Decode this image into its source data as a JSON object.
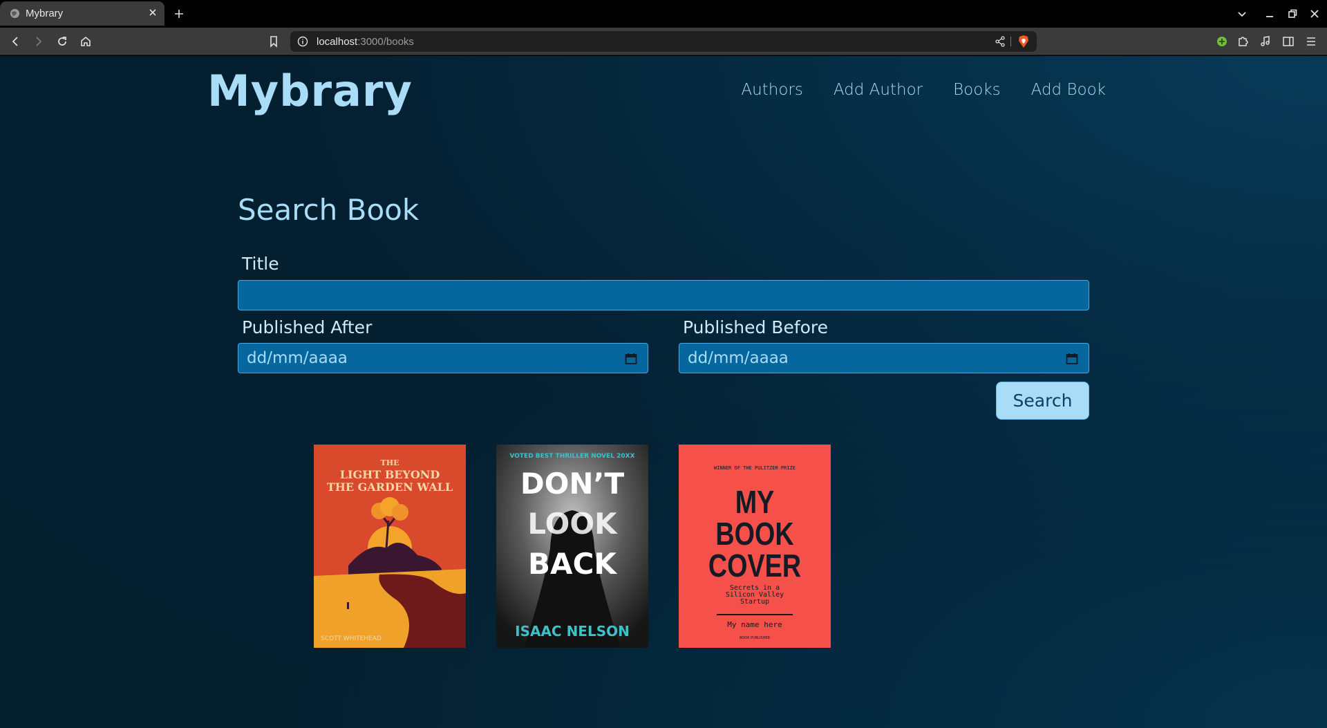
{
  "browser": {
    "tab_title": "Mybrary",
    "url_host": "localhost",
    "url_path": ":3000/books"
  },
  "header": {
    "brand": "Mybrary",
    "nav": [
      {
        "label": "Authors"
      },
      {
        "label": "Add Author"
      },
      {
        "label": "Books"
      },
      {
        "label": "Add Book"
      }
    ]
  },
  "search": {
    "heading": "Search Book",
    "title_label": "Title",
    "title_value": "",
    "published_after_label": "Published After",
    "published_after_placeholder": "dd/mm/aaaa",
    "published_before_label": "Published Before",
    "published_before_placeholder": "dd/mm/aaaa",
    "search_button": "Search"
  },
  "books": [
    {
      "cover_lines": [
        "THE",
        "LIGHT BEYOND",
        "THE GARDEN WALL"
      ],
      "author": "SCOTT WHITEHEAD",
      "colors": {
        "bg": "#d9492b",
        "sand": "#efa12a",
        "dark": "#6e1a1a",
        "title": "#f6d7a6"
      }
    },
    {
      "tagline": "VOTED BEST THRILLER NOVEL 20XX",
      "cover_lines": [
        "DON’T",
        "LOOK",
        "BACK"
      ],
      "author": "ISAAC NELSON",
      "colors": {
        "bg": "#2b2b2b",
        "accent": "#3bc1c8",
        "title": "#ffffff"
      }
    },
    {
      "tagline": "WINNER OF THE PULITZER PRIZE",
      "cover_lines": [
        "MY",
        "BOOK",
        "COVER"
      ],
      "subtitle_lines": [
        "Secrets in a",
        "Silicon Valley",
        "Startup"
      ],
      "author": "My name here",
      "publisher": "BOOK PUBLISHER",
      "colors": {
        "bg": "#f5504a",
        "title": "#161a24"
      }
    }
  ],
  "theme": {
    "accent": "#a8dcf7",
    "input_bg": "#05679d",
    "page_bg": "#03202f"
  }
}
